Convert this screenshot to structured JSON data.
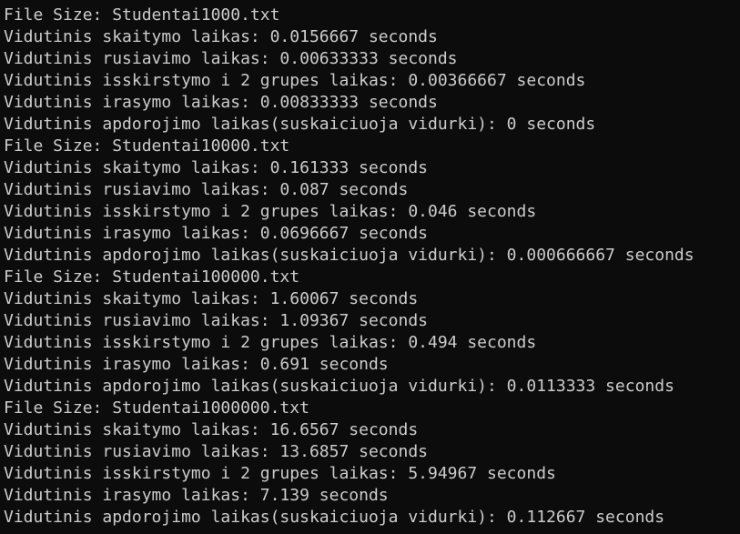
{
  "terminal": {
    "text_color": "#cccccc",
    "background_color": "#0c0c0c",
    "lines": [
      "File Size: Studentai1000.txt",
      "Vidutinis skaitymo laikas: 0.0156667 seconds",
      "Vidutinis rusiavimo laikas: 0.00633333 seconds",
      "Vidutinis isskirstymo i 2 grupes laikas: 0.00366667 seconds",
      "Vidutinis irasymo laikas: 0.00833333 seconds",
      "Vidutinis apdorojimo laikas(suskaiciuoja vidurki): 0 seconds",
      "File Size: Studentai10000.txt",
      "Vidutinis skaitymo laikas: 0.161333 seconds",
      "Vidutinis rusiavimo laikas: 0.087 seconds",
      "Vidutinis isskirstymo i 2 grupes laikas: 0.046 seconds",
      "Vidutinis irasymo laikas: 0.0696667 seconds",
      "Vidutinis apdorojimo laikas(suskaiciuoja vidurki): 0.000666667 seconds",
      "File Size: Studentai100000.txt",
      "Vidutinis skaitymo laikas: 1.60067 seconds",
      "Vidutinis rusiavimo laikas: 1.09367 seconds",
      "Vidutinis isskirstymo i 2 grupes laikas: 0.494 seconds",
      "Vidutinis irasymo laikas: 0.691 seconds",
      "Vidutinis apdorojimo laikas(suskaiciuoja vidurki): 0.0113333 seconds",
      "File Size: Studentai1000000.txt",
      "Vidutinis skaitymo laikas: 16.6567 seconds",
      "Vidutinis rusiavimo laikas: 13.6857 seconds",
      "Vidutinis isskirstymo i 2 grupes laikas: 5.94967 seconds",
      "Vidutinis irasymo laikas: 7.139 seconds",
      "Vidutinis apdorojimo laikas(suskaiciuoja vidurki): 0.112667 seconds"
    ]
  }
}
